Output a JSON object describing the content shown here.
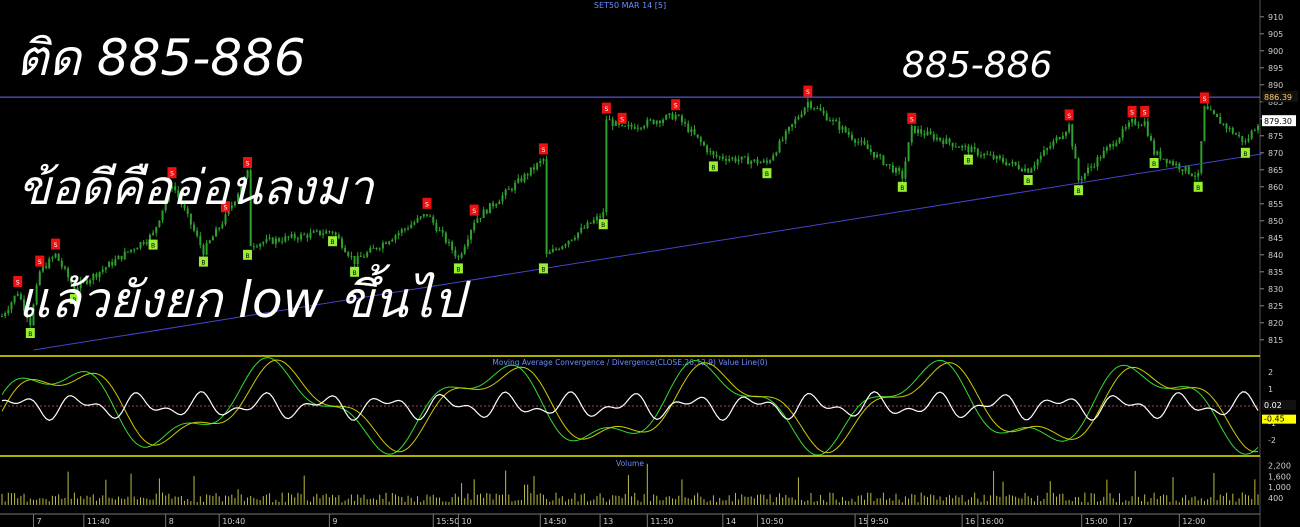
{
  "chart_title": "SET50 MAR 14  [5]",
  "annotations": {
    "line1": "ติด 885-886",
    "line2": "ข้อดีคืออ่อนลงมา",
    "line3": "แล้วยังยก low ขึ้นไป",
    "right": "885-886"
  },
  "colors": {
    "background": "#000000",
    "candle": "#2ea02e",
    "sell_marker": "#ee1111",
    "buy_marker": "#99ee33",
    "panel_border": "#e8e800",
    "trendline": "#4444cc",
    "price_readout": "#ffffff",
    "macd_main": "#33dd33",
    "macd_signal": "#cccc00",
    "value_line": "#ffffff",
    "volume_bar": "#bbbb44"
  },
  "chart_data": {
    "type": "candlestick",
    "price_axis": {
      "ticks": [
        910,
        905,
        900,
        895,
        890,
        885,
        880,
        875,
        870,
        865,
        860,
        855,
        850,
        845,
        840,
        835,
        830,
        825,
        820,
        815
      ],
      "range": [
        812,
        912
      ],
      "resistance_level": 886.39,
      "last_price": 879.3
    },
    "sell_markers": [
      {
        "idx": 5,
        "price": 832
      },
      {
        "idx": 12,
        "price": 838
      },
      {
        "idx": 17,
        "price": 843
      },
      {
        "idx": 54,
        "price": 864
      },
      {
        "idx": 71,
        "price": 854
      },
      {
        "idx": 78,
        "price": 867
      },
      {
        "idx": 135,
        "price": 855
      },
      {
        "idx": 150,
        "price": 853
      },
      {
        "idx": 172,
        "price": 871
      },
      {
        "idx": 192,
        "price": 883
      },
      {
        "idx": 197,
        "price": 880
      },
      {
        "idx": 214,
        "price": 884
      },
      {
        "idx": 256,
        "price": 888
      },
      {
        "idx": 289,
        "price": 880
      },
      {
        "idx": 339,
        "price": 881
      },
      {
        "idx": 359,
        "price": 882
      },
      {
        "idx": 363,
        "price": 882
      },
      {
        "idx": 382,
        "price": 886
      }
    ],
    "buy_markers": [
      {
        "idx": 9,
        "price": 817
      },
      {
        "idx": 23,
        "price": 827
      },
      {
        "idx": 48,
        "price": 843
      },
      {
        "idx": 64,
        "price": 838
      },
      {
        "idx": 78,
        "price": 840
      },
      {
        "idx": 105,
        "price": 844
      },
      {
        "idx": 112,
        "price": 835
      },
      {
        "idx": 145,
        "price": 836
      },
      {
        "idx": 172,
        "price": 836
      },
      {
        "idx": 191,
        "price": 849
      },
      {
        "idx": 226,
        "price": 866
      },
      {
        "idx": 243,
        "price": 864
      },
      {
        "idx": 286,
        "price": 860
      },
      {
        "idx": 307,
        "price": 868
      },
      {
        "idx": 326,
        "price": 862
      },
      {
        "idx": 342,
        "price": 859
      },
      {
        "idx": 366,
        "price": 867
      },
      {
        "idx": 380,
        "price": 860
      },
      {
        "idx": 395,
        "price": 870
      }
    ],
    "macd_panel": {
      "title": "Moving Average Convergence / Divergence(CLOSE,26,12,9) Value Line(0)",
      "ticks": [
        "2",
        "1",
        "0",
        "-1",
        "-2"
      ],
      "readouts": [
        "0.02",
        "-0.45"
      ]
    },
    "volume_panel": {
      "title": "Volume",
      "ticks": [
        "2,200",
        "1,600",
        "1,000",
        "400"
      ]
    },
    "time_axis": [
      {
        "label": "7",
        "idx": 10
      },
      {
        "label": "11:40",
        "idx": 26
      },
      {
        "label": "8",
        "idx": 52
      },
      {
        "label": "10:40",
        "idx": 69
      },
      {
        "label": "9",
        "idx": 104
      },
      {
        "label": "15:50",
        "idx": 137
      },
      {
        "label": "10",
        "idx": 145
      },
      {
        "label": "14:50",
        "idx": 171
      },
      {
        "label": "13",
        "idx": 190
      },
      {
        "label": "11:50",
        "idx": 205
      },
      {
        "label": "14",
        "idx": 229
      },
      {
        "label": "10:50",
        "idx": 240
      },
      {
        "label": "15",
        "idx": 271
      },
      {
        "label": "9:50",
        "idx": 275
      },
      {
        "label": "16",
        "idx": 305
      },
      {
        "label": "16:00",
        "idx": 310
      },
      {
        "label": "15:00",
        "idx": 343
      },
      {
        "label": "17",
        "idx": 355
      },
      {
        "label": "12:00",
        "idx": 374
      }
    ]
  }
}
